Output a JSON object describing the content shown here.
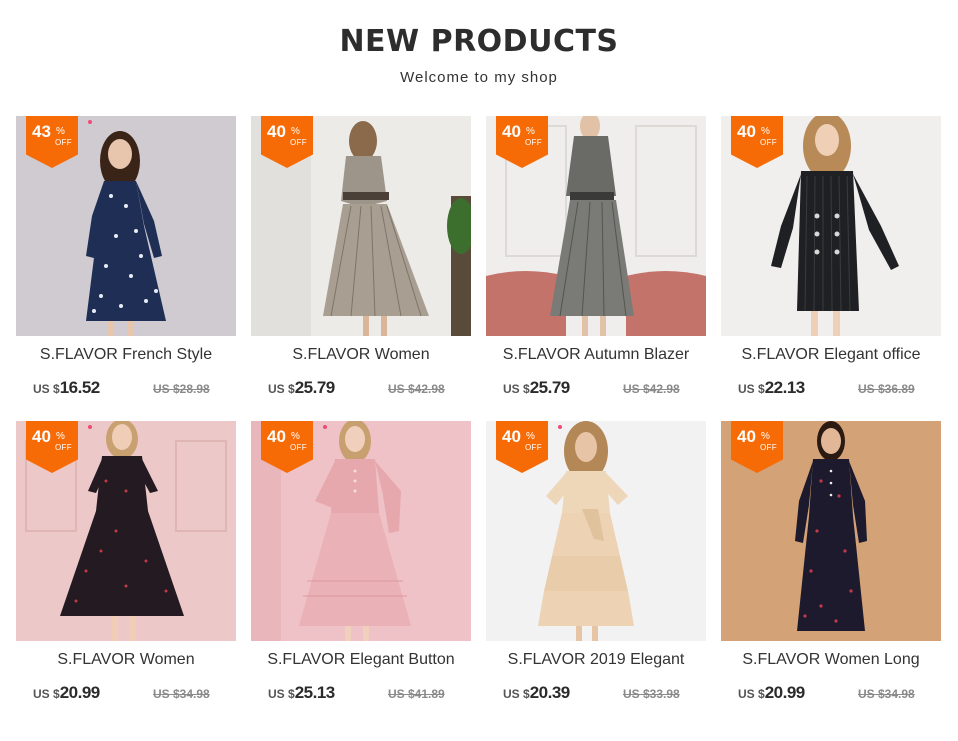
{
  "header": {
    "title": "NEW PRODUCTS",
    "subtitle": "Welcome to my shop"
  },
  "products": [
    {
      "name": "S.FLAVOR French Style",
      "discount": "43",
      "percent": "%",
      "off": "OFF",
      "currency": "US $",
      "price": "16.52",
      "old_price": "US $28.98"
    },
    {
      "name": "S.FLAVOR Women",
      "discount": "40",
      "percent": "%",
      "off": "OFF",
      "currency": "US $",
      "price": "25.79",
      "old_price": "US $42.98"
    },
    {
      "name": "S.FLAVOR Autumn Blazer",
      "discount": "40",
      "percent": "%",
      "off": "OFF",
      "currency": "US $",
      "price": "25.79",
      "old_price": "US $42.98"
    },
    {
      "name": "S.FLAVOR Elegant office",
      "discount": "40",
      "percent": "%",
      "off": "OFF",
      "currency": "US $",
      "price": "22.13",
      "old_price": "US $36.89"
    },
    {
      "name": "S.FLAVOR Women",
      "discount": "40",
      "percent": "%",
      "off": "OFF",
      "currency": "US $",
      "price": "20.99",
      "old_price": "US $34.98"
    },
    {
      "name": "S.FLAVOR Elegant Button",
      "discount": "40",
      "percent": "%",
      "off": "OFF",
      "currency": "US $",
      "price": "25.13",
      "old_price": "US $41.89"
    },
    {
      "name": "S.FLAVOR 2019 Elegant",
      "discount": "40",
      "percent": "%",
      "off": "OFF",
      "currency": "US $",
      "price": "20.39",
      "old_price": "US $33.98"
    },
    {
      "name": "S.FLAVOR Women Long",
      "discount": "40",
      "percent": "%",
      "off": "OFF",
      "currency": "US $",
      "price": "20.99",
      "old_price": "US $34.98"
    }
  ],
  "colors": {
    "badge": "#f76b07",
    "badge_dot": "#f04b78",
    "title": "#2d2d2d",
    "old_price": "#8a8a8a"
  }
}
